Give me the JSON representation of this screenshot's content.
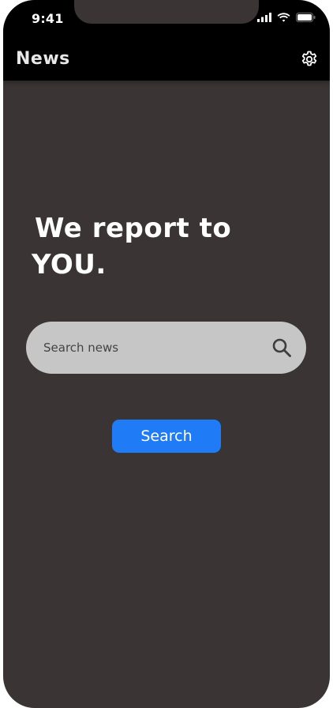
{
  "status_bar": {
    "time": "9:41",
    "icons": [
      "signal-icon",
      "wifi-icon",
      "battery-icon"
    ]
  },
  "header": {
    "title": "News",
    "settings_icon": "gear-icon"
  },
  "main": {
    "headline_line1": "We report to",
    "headline_line2": "YOU.",
    "search": {
      "placeholder": "Search news",
      "value": "",
      "icon": "search-icon"
    },
    "search_button_label": "Search"
  },
  "colors": {
    "background": "#3a3434",
    "header": "#000000",
    "search_field": "#c6c6c6",
    "accent": "#1f7bf6",
    "text_light": "#ffffff"
  }
}
